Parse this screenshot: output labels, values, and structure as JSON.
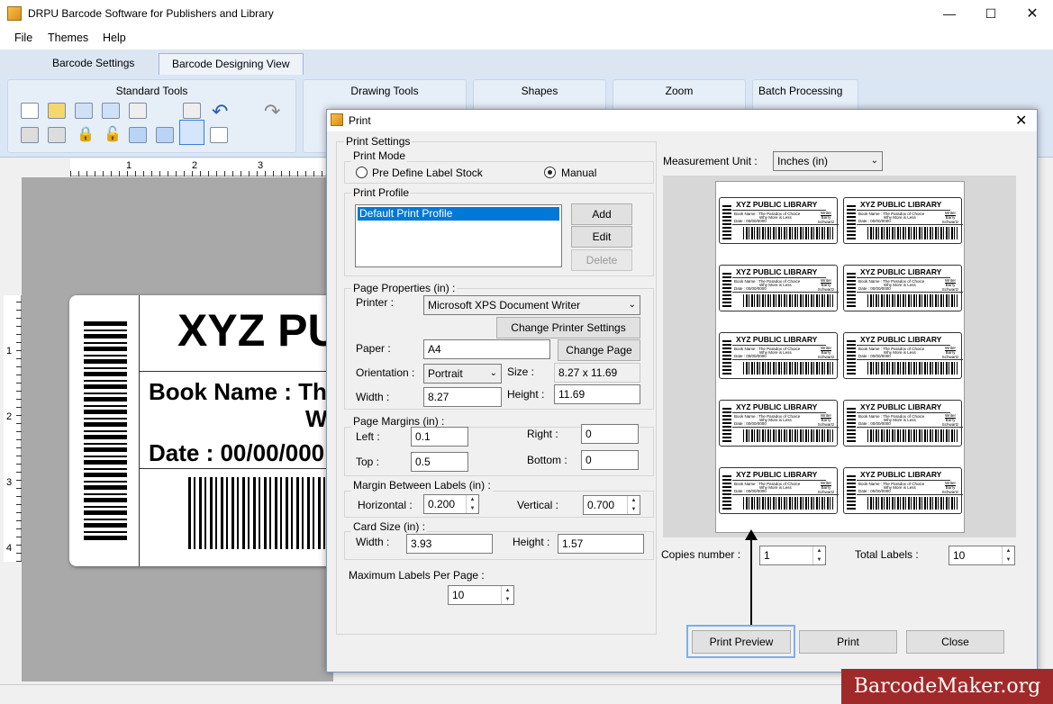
{
  "app": {
    "title": "DRPU Barcode Software for Publishers and Library",
    "menu": [
      "File",
      "Themes",
      "Help"
    ],
    "tabs": [
      "Barcode Settings",
      "Barcode Designing View"
    ],
    "ribbon_groups": [
      "Standard Tools",
      "Drawing Tools",
      "Shapes",
      "Zoom",
      "Batch Processing"
    ],
    "ruler_h": [
      "1",
      "2",
      "3"
    ],
    "ruler_v": [
      "1",
      "2",
      "3",
      "4"
    ]
  },
  "label": {
    "title": "XYZ PU",
    "book_name": "Book Name : Th",
    "book_name_cont": "W",
    "date": "Date : 00/00/000"
  },
  "dialog": {
    "title": "Print",
    "print_settings": "Print Settings",
    "print_mode": {
      "legend": "Print Mode",
      "option_predefined": "Pre Define Label Stock",
      "option_manual": "Manual",
      "selected": "Manual"
    },
    "print_profile": {
      "legend": "Print Profile",
      "items": [
        "Default Print Profile"
      ],
      "selected": "Default Print Profile",
      "add": "Add",
      "edit": "Edit",
      "delete": "Delete"
    },
    "page_properties": {
      "legend": "Page Properties (in) :",
      "printer_label": "Printer :",
      "printer_value": "Microsoft XPS Document Writer",
      "change_printer": "Change Printer Settings",
      "paper_label": "Paper :",
      "paper_value": "A4",
      "change_page": "Change Page",
      "orientation_label": "Orientation :",
      "orientation_value": "Portrait",
      "size_label": "Size :",
      "size_value": "8.27 x 11.69",
      "width_label": "Width :",
      "width_value": "8.27",
      "height_label": "Height :",
      "height_value": "11.69"
    },
    "page_margins": {
      "legend": "Page Margins (in) :",
      "left_label": "Left :",
      "left_value": "0.1",
      "right_label": "Right :",
      "right_value": "0",
      "top_label": "Top :",
      "top_value": "0.5",
      "bottom_label": "Bottom :",
      "bottom_value": "0"
    },
    "margin_between": {
      "legend": "Margin Between Labels (in) :",
      "horizontal_label": "Horizontal :",
      "horizontal_value": "0.200",
      "vertical_label": "Vertical :",
      "vertical_value": "0.700"
    },
    "card_size": {
      "legend": "Card Size (in) :",
      "width_label": "Width :",
      "width_value": "3.93",
      "height_label": "Height :",
      "height_value": "1.57"
    },
    "max_labels_label": "Maximum Labels Per Page :",
    "max_labels_value": "10",
    "measurement_label": "Measurement Unit :",
    "measurement_value": "Inches (in)",
    "copies_label": "Copies number :",
    "copies_value": "1",
    "total_label": "Total Labels :",
    "total_value": "10",
    "preview_label": {
      "title": "XYZ PUBLIC LIBRARY",
      "book_line": "Book Name : The Paradox of Choice",
      "book_line2": "Why More is Less",
      "date_line": "Date : 00/00/0000",
      "writer": "Writer",
      "writer_name": "Barry Schwartz"
    },
    "buttons": {
      "print_preview": "Print Preview",
      "print": "Print",
      "close": "Close"
    }
  },
  "watermark": "BarcodeMaker.org"
}
